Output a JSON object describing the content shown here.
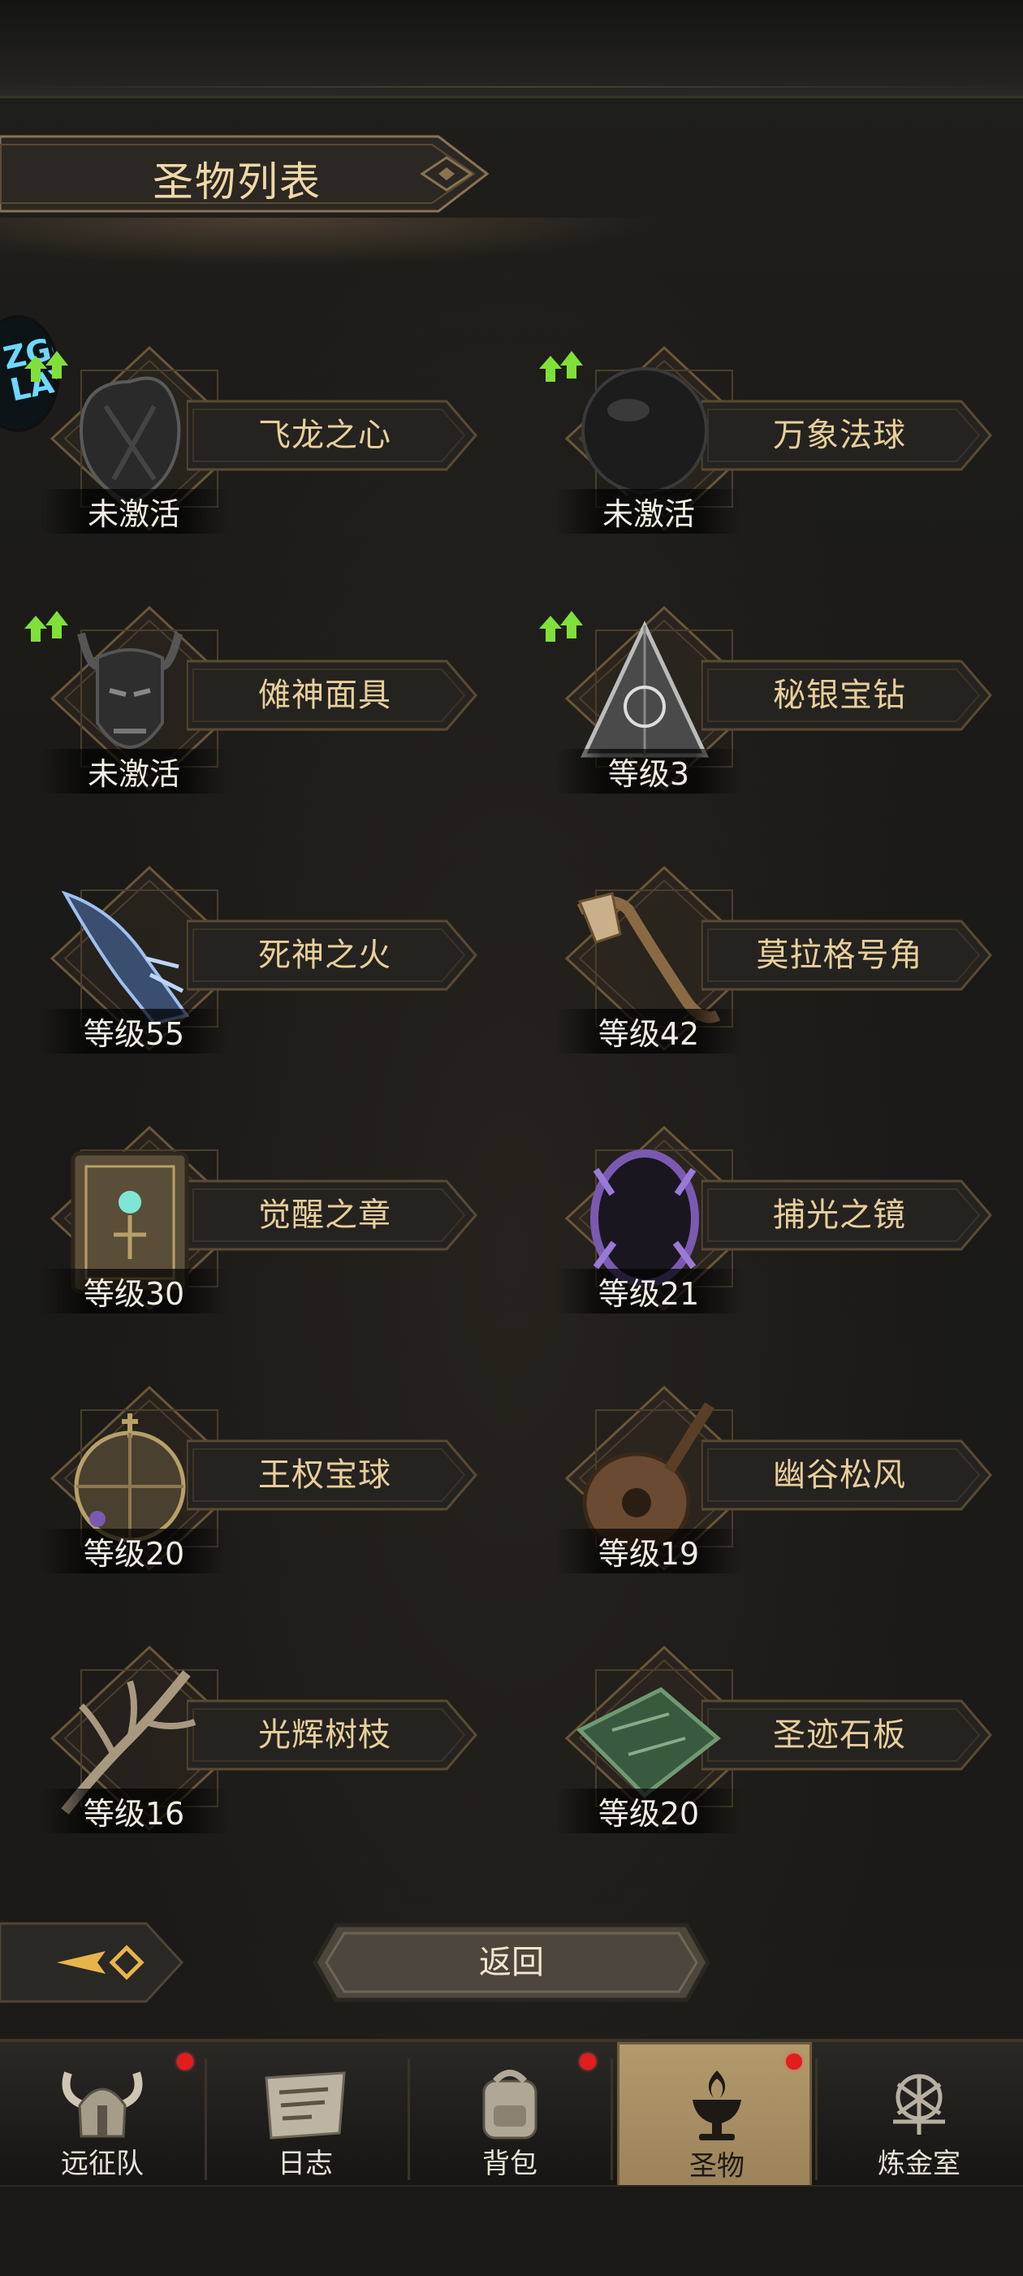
{
  "header": {
    "title": "圣物列表"
  },
  "side_avatar": {
    "text": "ZGO\nLAY"
  },
  "relics": [
    {
      "name": "飞龙之心",
      "status": "未激活",
      "upgrade": true,
      "art": "dragon-heart-icon",
      "accent": "#5a5a5a"
    },
    {
      "name": "万象法球",
      "status": "未激活",
      "upgrade": true,
      "art": "dark-orb-icon",
      "accent": "#3a3a3a"
    },
    {
      "name": "傩神面具",
      "status": "未激活",
      "upgrade": true,
      "art": "demon-mask-icon",
      "accent": "#4a4a4a"
    },
    {
      "name": "秘银宝钻",
      "status": "等级3",
      "upgrade": true,
      "art": "mithril-pyramid-icon",
      "accent": "#9a9a9a"
    },
    {
      "name": "死神之火",
      "status": "等级55",
      "upgrade": false,
      "art": "spectral-hand-icon",
      "accent": "#7fa4d8"
    },
    {
      "name": "莫拉格号角",
      "status": "等级42",
      "upgrade": false,
      "art": "war-horn-icon",
      "accent": "#8a6a45"
    },
    {
      "name": "觉醒之章",
      "status": "等级30",
      "upgrade": false,
      "art": "ancient-tome-icon",
      "accent": "#6e6550"
    },
    {
      "name": "捕光之镜",
      "status": "等级21",
      "upgrade": false,
      "art": "crystal-mirror-icon",
      "accent": "#7a5ab0"
    },
    {
      "name": "王权宝球",
      "status": "等级20",
      "upgrade": false,
      "art": "royal-orb-icon",
      "accent": "#8a7a50"
    },
    {
      "name": "幽谷松风",
      "status": "等级19",
      "upgrade": false,
      "art": "lute-icon",
      "accent": "#7a5a40"
    },
    {
      "name": "光辉树枝",
      "status": "等级16",
      "upgrade": false,
      "art": "branch-icon",
      "accent": "#9a8a70"
    },
    {
      "name": "圣迹石板",
      "status": "等级20",
      "upgrade": false,
      "art": "stone-tablet-icon",
      "accent": "#4e6e50"
    }
  ],
  "buttons": {
    "back": "返回"
  },
  "nav": [
    {
      "label": "远征队",
      "icon": "viking-helmet-icon",
      "badge": true,
      "active": false
    },
    {
      "label": "日志",
      "icon": "scroll-map-icon",
      "badge": false,
      "active": false
    },
    {
      "label": "背包",
      "icon": "backpack-icon",
      "badge": true,
      "active": false
    },
    {
      "label": "圣物",
      "icon": "chalice-flame-icon",
      "badge": true,
      "active": true
    },
    {
      "label": "炼金室",
      "icon": "alchemy-icon",
      "badge": false,
      "active": false
    }
  ],
  "colors": {
    "gold": "#e8cf9a",
    "badge": "#e21d1d",
    "upgrade": "#7fe03a",
    "active_tab": "#b39a6c"
  }
}
